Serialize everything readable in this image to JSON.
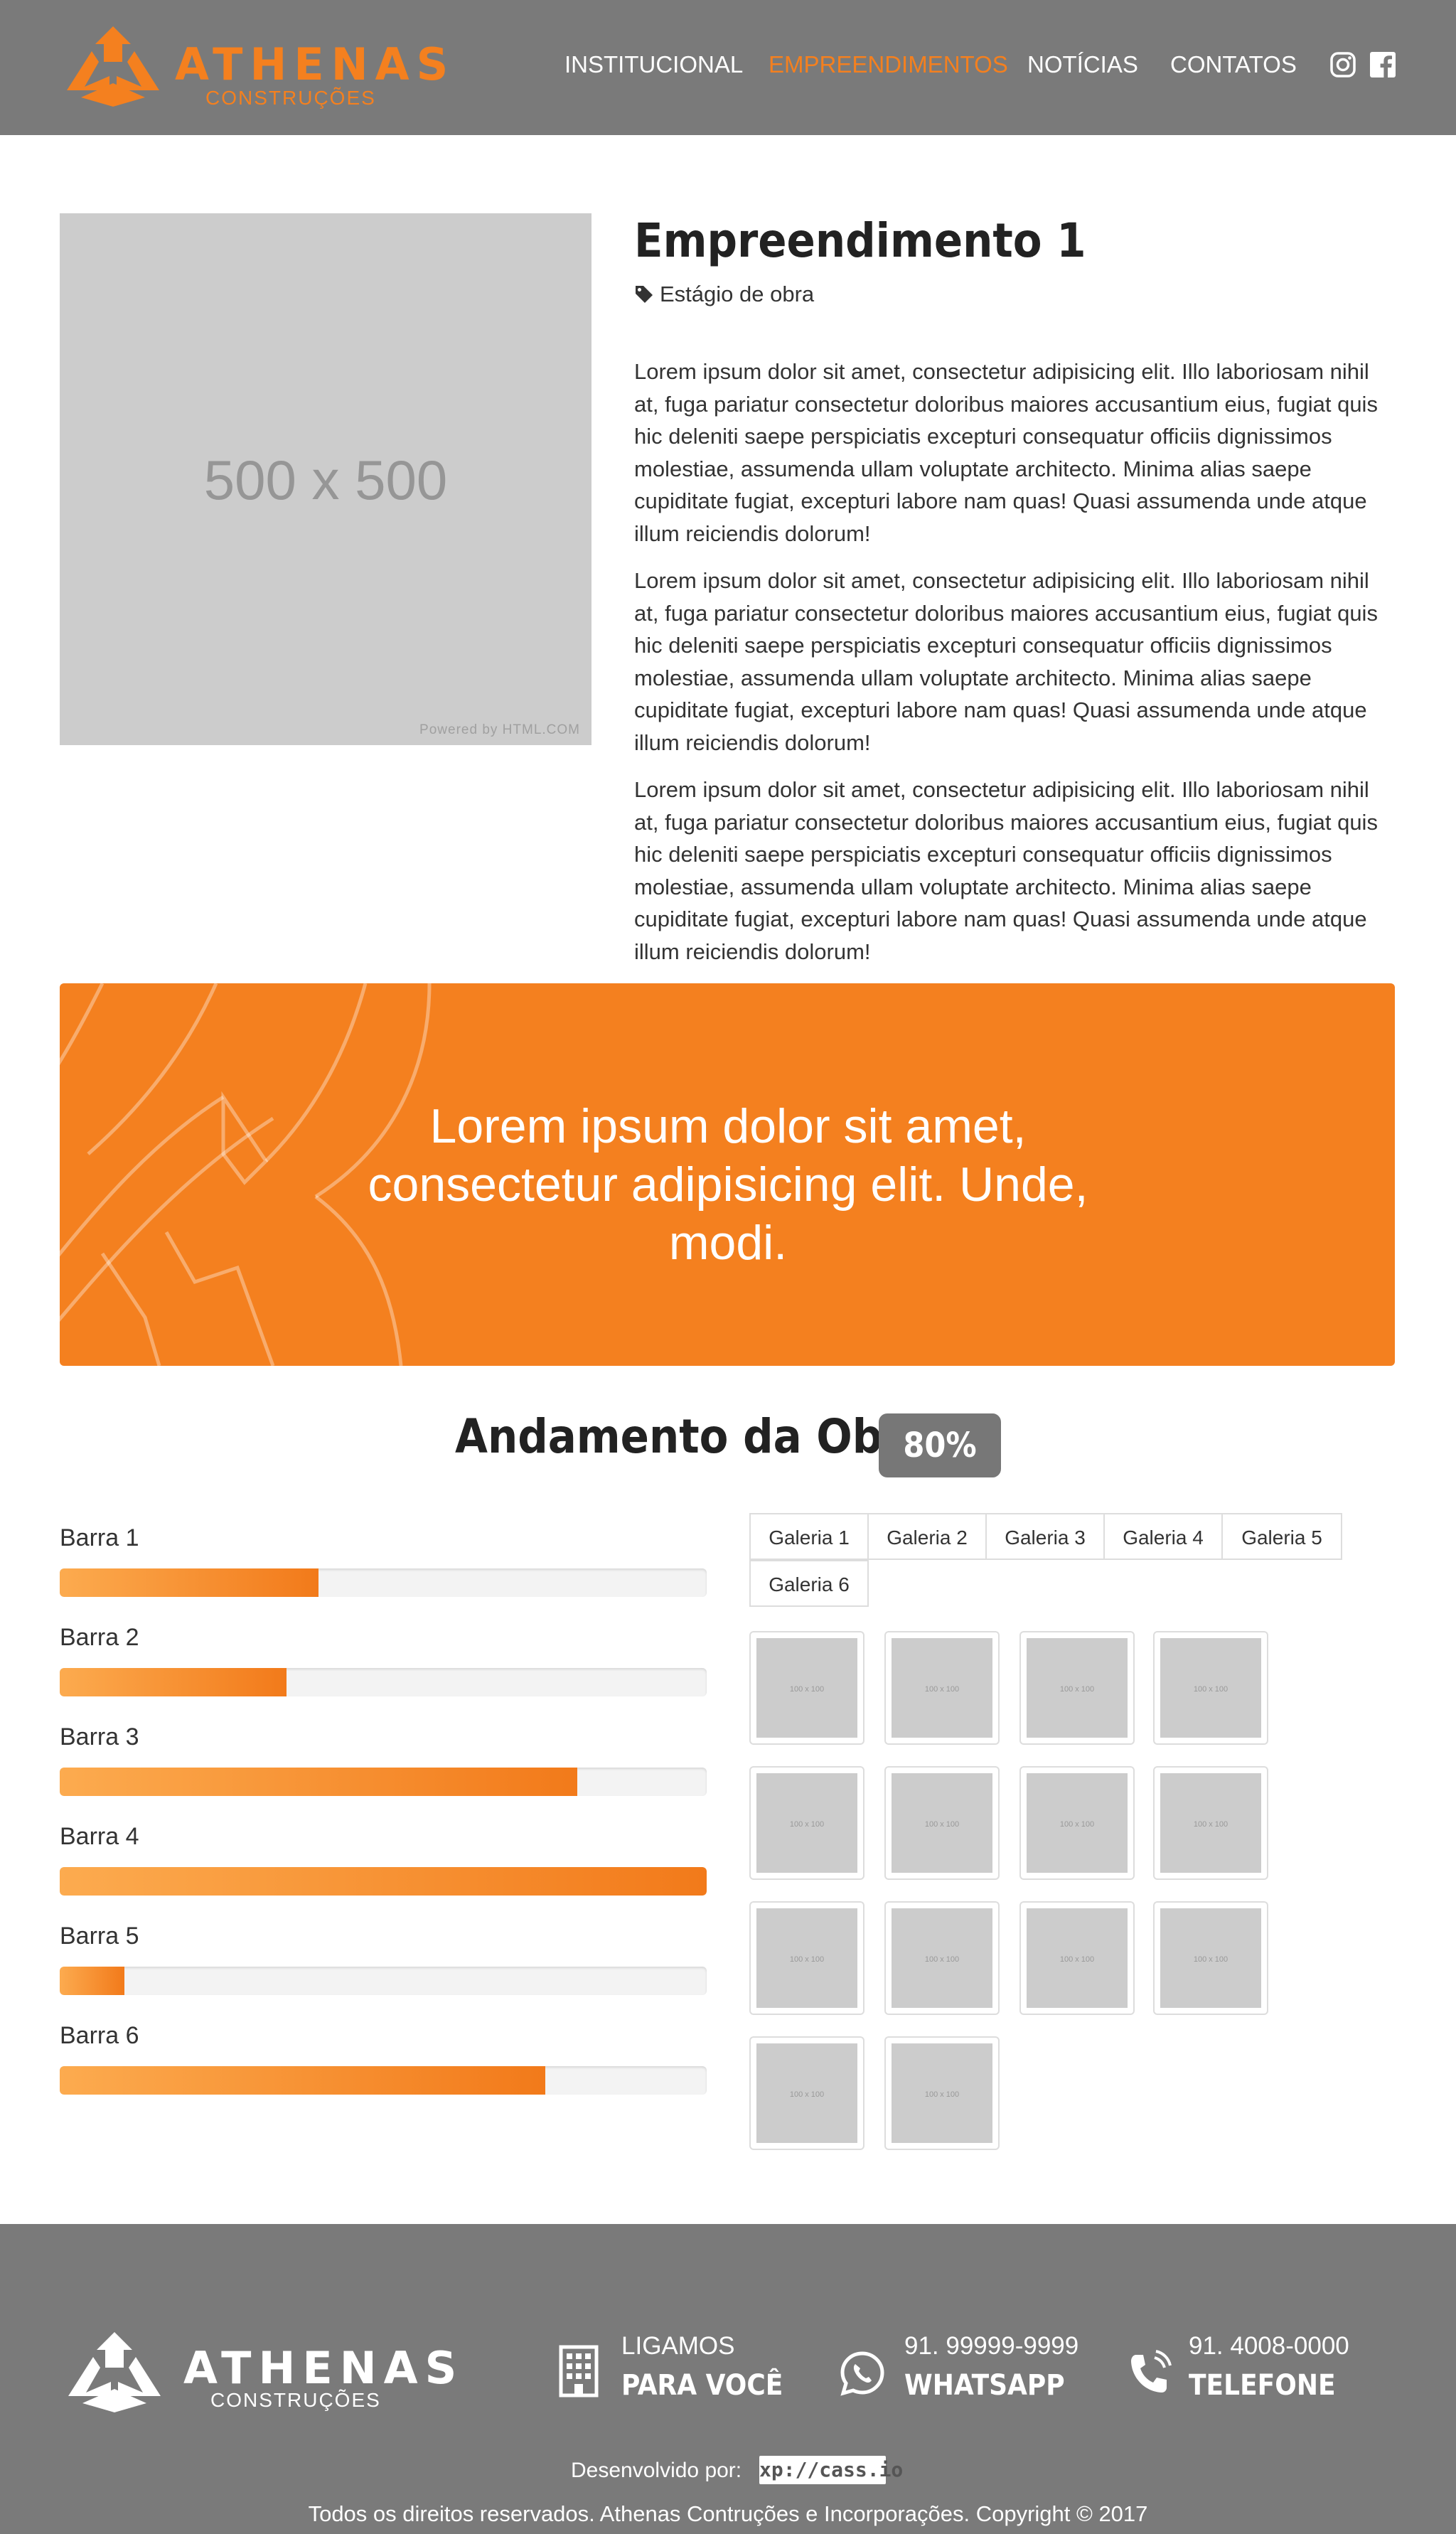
{
  "brand": {
    "name": "ATHENAS",
    "sub": "CONSTRUÇÕES"
  },
  "nav": [
    {
      "label": "INSTITUCIONAL",
      "active": false
    },
    {
      "label": "EMPREENDIMENTOS",
      "active": true
    },
    {
      "label": "NOTÍCIAS",
      "active": false
    },
    {
      "label": "CONTATOS",
      "active": false
    }
  ],
  "social": [
    "instagram-icon",
    "facebook-icon"
  ],
  "project": {
    "image_placeholder": "500 x 500",
    "image_credit": "Powered by HTML.COM",
    "title": "Empreendimento 1",
    "stage": "Estágio de obra",
    "paragraphs": [
      "Lorem ipsum dolor sit amet, consectetur adipisicing elit. Illo laboriosam nihil at, fuga pariatur consectetur doloribus maiores accusantium eius, fugiat quis hic deleniti saepe perspiciatis excepturi consequatur officiis dignissimos molestiae, assumenda ullam voluptate architecto. Minima alias saepe cupiditate fugiat, excepturi labore nam quas! Quasi assumenda unde atque illum reiciendis dolorum!",
      "Lorem ipsum dolor sit amet, consectetur adipisicing elit. Illo laboriosam nihil at, fuga pariatur consectetur doloribus maiores accusantium eius, fugiat quis hic deleniti saepe perspiciatis excepturi consequatur officiis dignissimos molestiae, assumenda ullam voluptate architecto. Minima alias saepe cupiditate fugiat, excepturi labore nam quas! Quasi assumenda unde atque illum reiciendis dolorum!",
      "Lorem ipsum dolor sit amet, consectetur adipisicing elit. Illo laboriosam nihil at, fuga pariatur consectetur doloribus maiores accusantium eius, fugiat quis hic deleniti saepe perspiciatis excepturi consequatur officiis dignissimos molestiae, assumenda ullam voluptate architecto. Minima alias saepe cupiditate fugiat, excepturi labore nam quas! Quasi assumenda unde atque illum reiciendis dolorum!"
    ]
  },
  "banner": {
    "text": "Lorem ipsum dolor sit amet, consectetur adipisicing elit. Unde, modi."
  },
  "progress": {
    "title": "Andamento da Obra",
    "percent": "80%",
    "bars": [
      {
        "label": "Barra 1",
        "value": 0.4
      },
      {
        "label": "Barra 2",
        "value": 0.35
      },
      {
        "label": "Barra 3",
        "value": 0.8
      },
      {
        "label": "Barra 4",
        "value": 1.0
      },
      {
        "label": "Barra 5",
        "value": 0.1
      },
      {
        "label": "Barra 6",
        "value": 0.75
      }
    ]
  },
  "gallery": {
    "tabs": [
      "Galeria 1",
      "Galeria 2",
      "Galeria 3",
      "Galeria 4",
      "Galeria 5",
      "Galeria 6"
    ],
    "thumb_label": "100 x 100",
    "thumb_count": 14
  },
  "footer": {
    "callback_top": "LIGAMOS",
    "callback_bottom": "PARA VOCÊ",
    "whatsapp_number": "91. 99999-9999",
    "whatsapp_label": "WHATSAPP",
    "phone_number": "91. 4008-0000",
    "phone_label": "TELEFONE",
    "developed_by": "Desenvolvido por:",
    "developer": "xp://cass.io",
    "copyright": "Todos os direitos reservados. Athenas Contruções e Incorporações. Copyright © 2017"
  },
  "colors": {
    "accent": "#f4801f",
    "header_bg": "#7a7a7a",
    "badge_bg": "#777777"
  }
}
